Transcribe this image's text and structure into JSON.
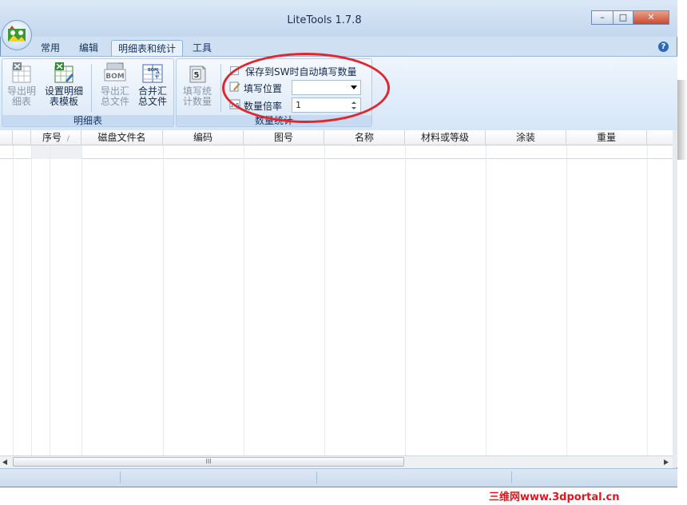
{
  "window": {
    "title": "LiteTools 1.7.8",
    "minimize": "–",
    "maximize": "□",
    "close": "✕",
    "help": "?"
  },
  "tabs": [
    {
      "label": "常用"
    },
    {
      "label": "编辑"
    },
    {
      "label": "明细表和统计",
      "active": true
    },
    {
      "label": "工具"
    }
  ],
  "ribbon": {
    "group1": {
      "label": "明细表",
      "buttons": [
        {
          "line1": "导出明",
          "line2": "细表",
          "enabled": false,
          "icon": "excel-export-icon"
        },
        {
          "line1": "设置明细",
          "line2": "表模板",
          "enabled": true,
          "icon": "excel-template-icon"
        },
        {
          "line1": "导出汇",
          "line2": "总文件",
          "enabled": false,
          "icon": "bom-icon"
        },
        {
          "line1": "合并汇",
          "line2": "总文件",
          "enabled": true,
          "icon": "bom-merge-icon"
        }
      ]
    },
    "group2": {
      "label": "数量统计",
      "fill_button": {
        "line1": "填写统",
        "line2": "计数量",
        "enabled": false,
        "icon": "count-icon",
        "glyph": "5"
      },
      "autofill_checkbox": "保存到SW时自动填写数量",
      "fill_position_label": "填写位置",
      "fill_position_value": "",
      "qty_ratio_label": "数量倍率",
      "qty_ratio_value": "1"
    }
  },
  "grid": {
    "columns": [
      "",
      "",
      "序号",
      "磁盘文件名",
      "编码",
      "图号",
      "名称",
      "材料或等级",
      "涂装",
      "重量"
    ],
    "sort_indicator": "/",
    "scroll_thumb": "III"
  },
  "watermark": "三维网www.3dportal.cn",
  "colors": {
    "annotation": "#e0262e",
    "ribbon": "#d6e6f7"
  }
}
